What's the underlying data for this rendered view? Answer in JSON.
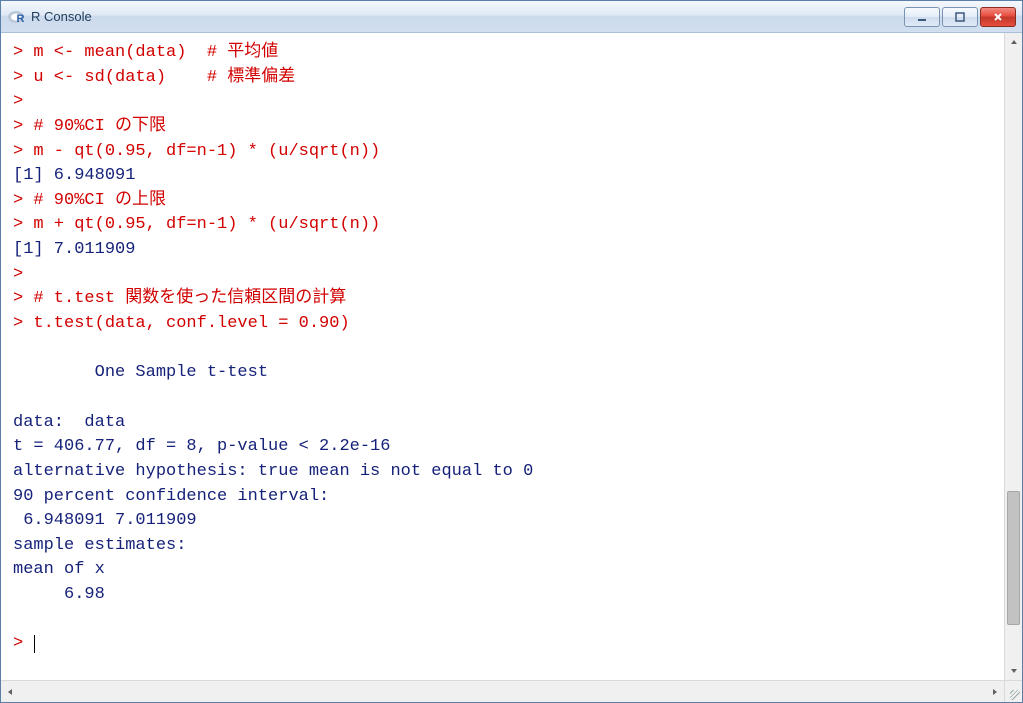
{
  "window": {
    "title": "R Console"
  },
  "console": {
    "lines": [
      {
        "cls": "r",
        "text": "> m <- mean(data)  # 平均値"
      },
      {
        "cls": "r",
        "text": "> u <- sd(data)    # 標準偏差"
      },
      {
        "cls": "r",
        "text": ">"
      },
      {
        "cls": "r",
        "text": "> # 90%CI の下限"
      },
      {
        "cls": "r",
        "text": "> m - qt(0.95, df=n-1) * (u/sqrt(n))"
      },
      {
        "cls": "b",
        "text": "[1] 6.948091"
      },
      {
        "cls": "r",
        "text": "> # 90%CI の上限"
      },
      {
        "cls": "r",
        "text": "> m + qt(0.95, df=n-1) * (u/sqrt(n))"
      },
      {
        "cls": "b",
        "text": "[1] 7.011909"
      },
      {
        "cls": "r",
        "text": ">"
      },
      {
        "cls": "r",
        "text": "> # t.test 関数を使った信頼区間の計算"
      },
      {
        "cls": "r",
        "text": "> t.test(data, conf.level = 0.90)"
      },
      {
        "cls": "b",
        "text": ""
      },
      {
        "cls": "b",
        "text": "        One Sample t-test"
      },
      {
        "cls": "b",
        "text": ""
      },
      {
        "cls": "b",
        "text": "data:  data"
      },
      {
        "cls": "b",
        "text": "t = 406.77, df = 8, p-value < 2.2e-16"
      },
      {
        "cls": "b",
        "text": "alternative hypothesis: true mean is not equal to 0"
      },
      {
        "cls": "b",
        "text": "90 percent confidence interval:"
      },
      {
        "cls": "b",
        "text": " 6.948091 7.011909"
      },
      {
        "cls": "b",
        "text": "sample estimates:"
      },
      {
        "cls": "b",
        "text": "mean of x "
      },
      {
        "cls": "b",
        "text": "     6.98 "
      },
      {
        "cls": "b",
        "text": ""
      }
    ],
    "prompt": "> "
  },
  "scrollbar": {
    "thumb_top_pct": 72,
    "thumb_height_pct": 22
  }
}
